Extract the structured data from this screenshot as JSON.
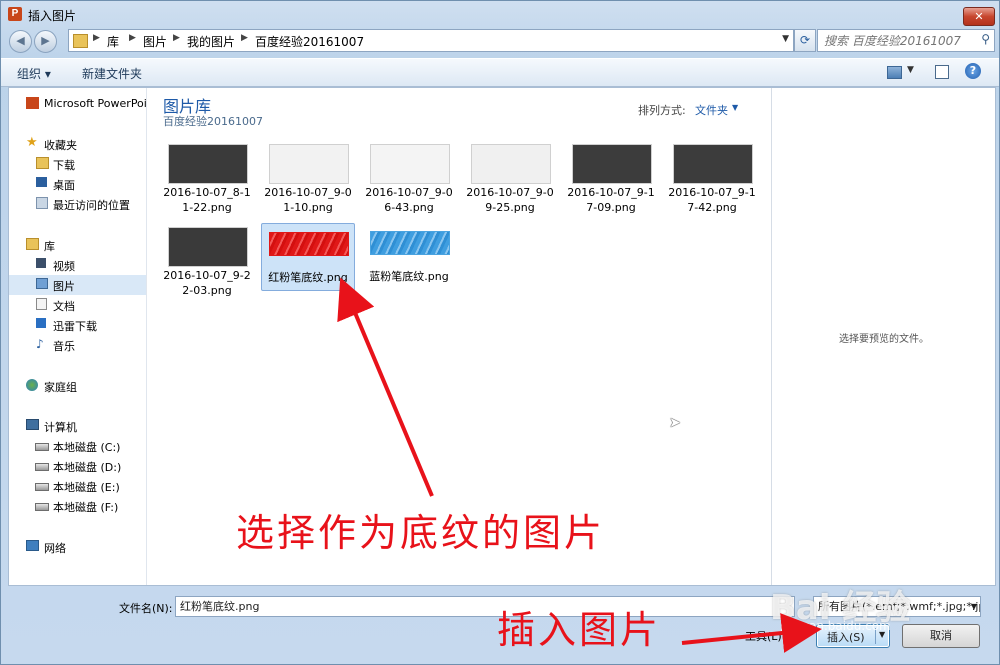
{
  "window": {
    "title": "插入图片",
    "app_icon": "P",
    "close": "✕"
  },
  "address_bar": {
    "crumbs": [
      "库",
      "图片",
      "我的图片",
      "百度经验20161007"
    ],
    "search_placeholder": "搜索 百度经验20161007"
  },
  "toolbar": {
    "organize": "组织 ▾",
    "new_folder": "新建文件夹"
  },
  "sidebar": {
    "items": [
      {
        "label": "Microsoft PowerPoi",
        "icon": "powerpoint-icon"
      },
      {
        "label": "收藏夹",
        "icon": "star-icon"
      },
      {
        "label": "下载",
        "icon": "download-folder-icon"
      },
      {
        "label": "桌面",
        "icon": "desktop-icon"
      },
      {
        "label": "最近访问的位置",
        "icon": "recent-places-icon"
      },
      {
        "label": "库",
        "icon": "library-icon"
      },
      {
        "label": "视频",
        "icon": "video-icon"
      },
      {
        "label": "图片",
        "icon": "pictures-icon"
      },
      {
        "label": "文档",
        "icon": "documents-icon"
      },
      {
        "label": "迅雷下载",
        "icon": "thunder-download-icon"
      },
      {
        "label": "音乐",
        "icon": "music-icon"
      },
      {
        "label": "家庭组",
        "icon": "homegroup-icon"
      },
      {
        "label": "计算机",
        "icon": "computer-icon"
      },
      {
        "label": "本地磁盘 (C:)",
        "icon": "drive-icon"
      },
      {
        "label": "本地磁盘 (D:)",
        "icon": "drive-icon"
      },
      {
        "label": "本地磁盘 (E:)",
        "icon": "drive-icon"
      },
      {
        "label": "本地磁盘 (F:)",
        "icon": "drive-icon"
      },
      {
        "label": "网络",
        "icon": "network-icon"
      }
    ]
  },
  "library": {
    "title": "图片库",
    "subtitle": "百度经验20161007",
    "arrange_label": "排列方式:",
    "arrange_value": "文件夹"
  },
  "files": [
    {
      "line1": "2016-10-07_8-1",
      "line2": "1-22.png",
      "style": "dark-slide"
    },
    {
      "line1": "2016-10-07_9-0",
      "line2": "1-10.png",
      "style": "light-slide"
    },
    {
      "line1": "2016-10-07_9-0",
      "line2": "6-43.png",
      "style": "light-slide"
    },
    {
      "line1": "2016-10-07_9-0",
      "line2": "9-25.png",
      "style": "light-slide"
    },
    {
      "line1": "2016-10-07_9-1",
      "line2": "7-09.png",
      "style": "dark-slide"
    },
    {
      "line1": "2016-10-07_9-1",
      "line2": "7-42.png",
      "style": "dark-slide"
    },
    {
      "line1": "2016-10-07_9-2",
      "line2": "2-03.png",
      "style": "dark-slide"
    },
    {
      "line1": "红粉笔底纹.png",
      "line2": "",
      "style": "red-chalk",
      "selected": true
    },
    {
      "line1": "蓝粉笔底纹.png",
      "line2": "",
      "style": "blue-chalk"
    }
  ],
  "preview": {
    "empty_text": "选择要预览的文件。"
  },
  "bottom": {
    "filename_label": "文件名(N):",
    "filename_value": "红粉笔底纹.png",
    "filetype_value": "所有图片(*.emf;*.wmf;*.jpg;*.jp",
    "tools_label": "工具(L)",
    "insert_label": "插入(S)",
    "cancel_label": "取消"
  },
  "annotations": {
    "main": "选择作为底纹的图片",
    "secondary": "插入图片",
    "color": "#e8121a"
  },
  "watermark": {
    "text": "Bai 经验",
    "sub": "jingyan.baidu.com"
  }
}
